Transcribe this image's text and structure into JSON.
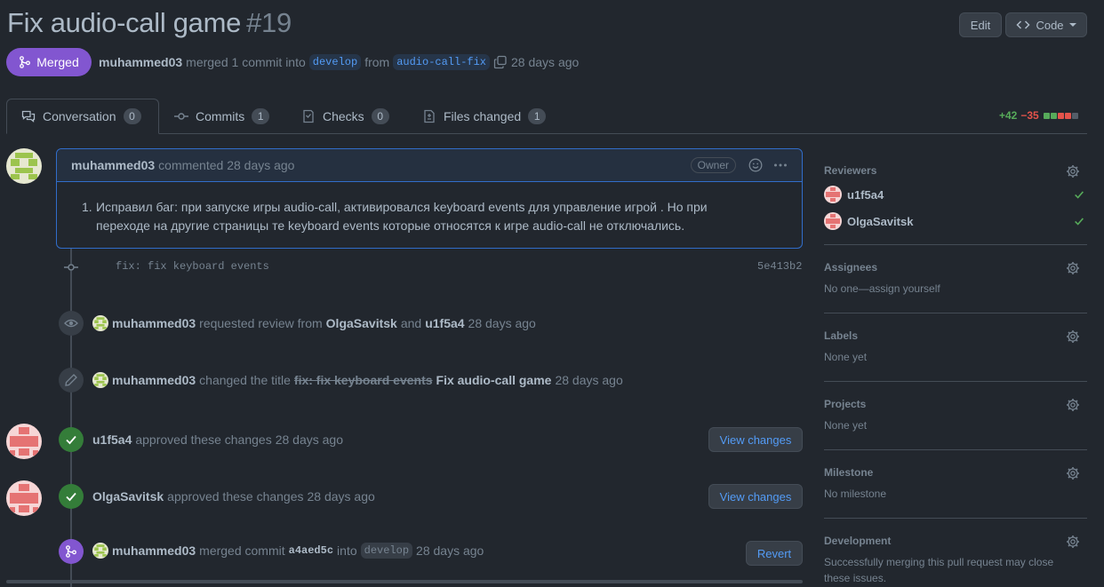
{
  "pr": {
    "title": "Fix audio-call game",
    "number": "#19",
    "edit_label": "Edit",
    "code_label": "Code",
    "status": "Merged",
    "author": "muhammed03",
    "merged_text": "merged 1 commit into",
    "base_branch": "develop",
    "from_text": "from",
    "head_branch": "audio-call-fix",
    "time": "28 days ago"
  },
  "tabs": [
    {
      "label": "Conversation",
      "count": "0"
    },
    {
      "label": "Commits",
      "count": "1"
    },
    {
      "label": "Checks",
      "count": "0"
    },
    {
      "label": "Files changed",
      "count": "1"
    }
  ],
  "diffstat": {
    "additions": "+42",
    "deletions": "−35"
  },
  "colors": {
    "accent": "#539bf5",
    "merged": "#8256d0",
    "success": "#347d39",
    "danger": "#e5534b",
    "add": "#57ab5a"
  },
  "comment": {
    "author": "muhammed03",
    "meta": "commented 28 days ago",
    "role": "Owner",
    "item_number": "1.",
    "item_line1": "Исправил баг: при запуске игры audio-call, активировался keyboard events для управление игрой . Но при",
    "item_line2": "переходе на другие страницы те keyboard events которые относятся к игре audio-call не отключались."
  },
  "commit": {
    "message": "fix: fix keyboard events",
    "sha": "5e413b2"
  },
  "events": {
    "review_request": {
      "actor": "muhammed03",
      "text": "requested review from",
      "reviewer1": "OlgaSavitsk",
      "and": "and",
      "reviewer2": "u1f5a4",
      "time": "28 days ago"
    },
    "rename": {
      "actor": "muhammed03",
      "text": "changed the title",
      "old_title": "fix: fix keyboard events",
      "new_title": "Fix audio-call game",
      "time": "28 days ago"
    },
    "approval1": {
      "actor": "u1f5a4",
      "text": "approved these changes",
      "time": "28 days ago",
      "button": "View changes"
    },
    "approval2": {
      "actor": "OlgaSavitsk",
      "text": "approved these changes",
      "time": "28 days ago",
      "button": "View changes"
    },
    "merge": {
      "actor": "muhammed03",
      "text": "merged commit",
      "sha": "a4aed5c",
      "into": "into",
      "branch": "develop",
      "time": "28 days ago",
      "button": "Revert"
    }
  },
  "sidebar": {
    "reviewers": {
      "title": "Reviewers",
      "items": [
        "u1f5a4",
        "OlgaSavitsk"
      ]
    },
    "assignees": {
      "title": "Assignees",
      "value": "No one—assign yourself"
    },
    "labels": {
      "title": "Labels",
      "value": "None yet"
    },
    "projects": {
      "title": "Projects",
      "value": "None yet"
    },
    "milestone": {
      "title": "Milestone",
      "value": "No milestone"
    },
    "development": {
      "title": "Development",
      "value": "Successfully merging this pull request may close these issues."
    }
  }
}
